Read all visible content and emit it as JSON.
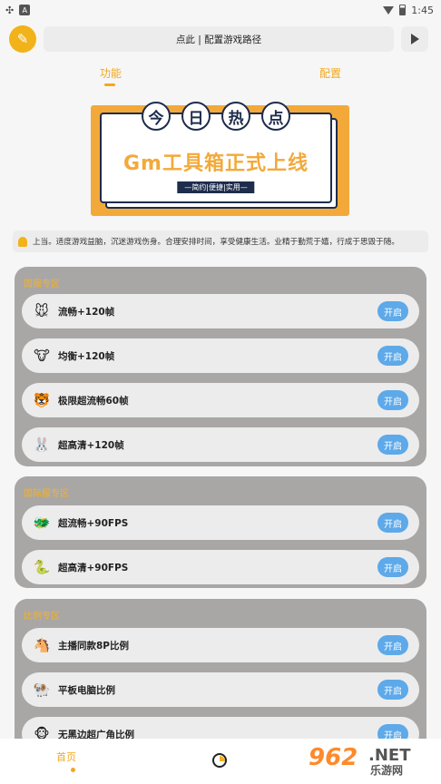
{
  "statusbar": {
    "time": "1:45",
    "left_icon_text": "A"
  },
  "topbar": {
    "path_label": "点此 | 配置游戏路径"
  },
  "tabs": [
    {
      "label": "功能"
    },
    {
      "label": "配置"
    }
  ],
  "banner": {
    "hot_chars": [
      "今",
      "日",
      "热",
      "点"
    ],
    "title": "Gm工具箱正式上线",
    "subtitle": "—简约|便捷|实用—"
  },
  "notice": {
    "text": "上当。适度游戏益脑，沉迷游戏伤身。合理安排时间，享受健康生活。业精于勤荒于嬉，行成于思毁于随。"
  },
  "sections": [
    {
      "title": "国服专区",
      "items": [
        {
          "label": "流畅+120帧",
          "button": "开启",
          "icon": "mouse-icon"
        },
        {
          "label": "均衡+120帧",
          "button": "开启",
          "icon": "cow-icon"
        },
        {
          "label": "极限超流畅60帧",
          "button": "开启",
          "icon": "tiger-icon"
        },
        {
          "label": "超高清+120帧",
          "button": "开启",
          "icon": "rabbit-icon"
        }
      ]
    },
    {
      "title": "国际服专区",
      "items": [
        {
          "label": "超流畅+90FPS",
          "button": "开启",
          "icon": "dragon-icon"
        },
        {
          "label": "超高清+90FPS",
          "button": "开启",
          "icon": "snake-icon"
        }
      ]
    },
    {
      "title": "比例专区",
      "items": [
        {
          "label": "主播同款8P比例",
          "button": "开启",
          "icon": "horse-icon"
        },
        {
          "label": "平板电脑比例",
          "button": "开启",
          "icon": "goat-icon"
        },
        {
          "label": "无黑边超广角比例",
          "button": "开启",
          "icon": "monkey-icon"
        }
      ]
    }
  ],
  "bottomnav": {
    "home_label": "首页"
  },
  "watermark": {
    "number": "962",
    "net": ".NET",
    "cn": "乐游网"
  }
}
